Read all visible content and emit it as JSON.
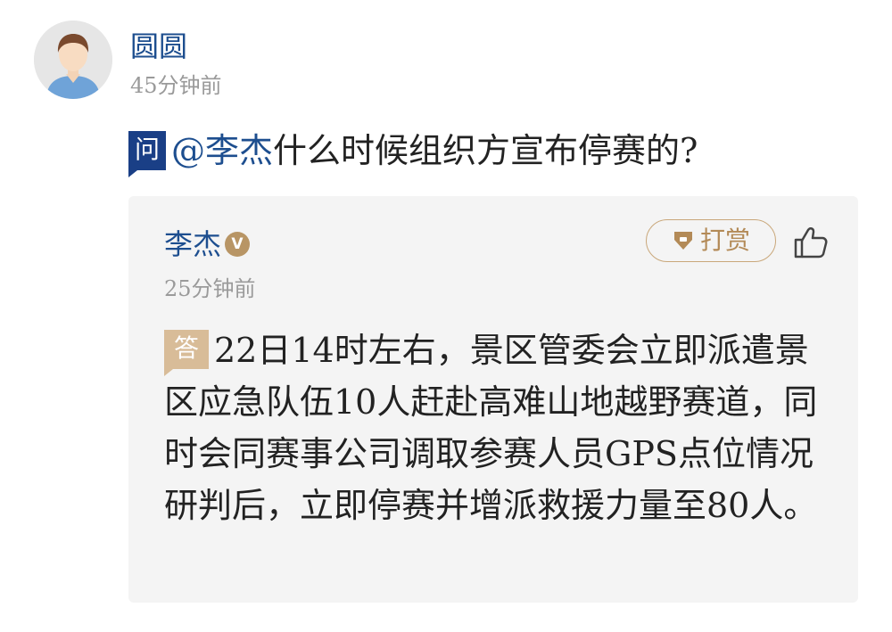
{
  "question": {
    "author": {
      "name": "圆圆",
      "time": "45分钟前"
    },
    "badge": "问",
    "mention": "@李杰",
    "text": "什么时候组织方宣布停赛的?"
  },
  "answer": {
    "author": {
      "name": "李杰",
      "verified_badge": "V",
      "time": "25分钟前"
    },
    "reward_label": "打赏",
    "badge": "答",
    "text": "22日14时左右，景区管委会立即派遣景区应急队伍10人赶赴高难山地越野赛道，同时会同赛事公司调取参赛人员GPS点位情况研判后，立即停赛并增派救援力量至80人。"
  },
  "icons": {
    "avatar": "default-avatar-icon",
    "reward": "diamond-gift-icon",
    "like": "thumbs-up-icon"
  },
  "colors": {
    "link_blue": "#1d4e8f",
    "question_badge": "#1a3f86",
    "answer_badge": "#d8bc98",
    "gold_accent": "#b89565",
    "card_background": "#f4f4f4",
    "muted_text": "#9a9a9a"
  }
}
